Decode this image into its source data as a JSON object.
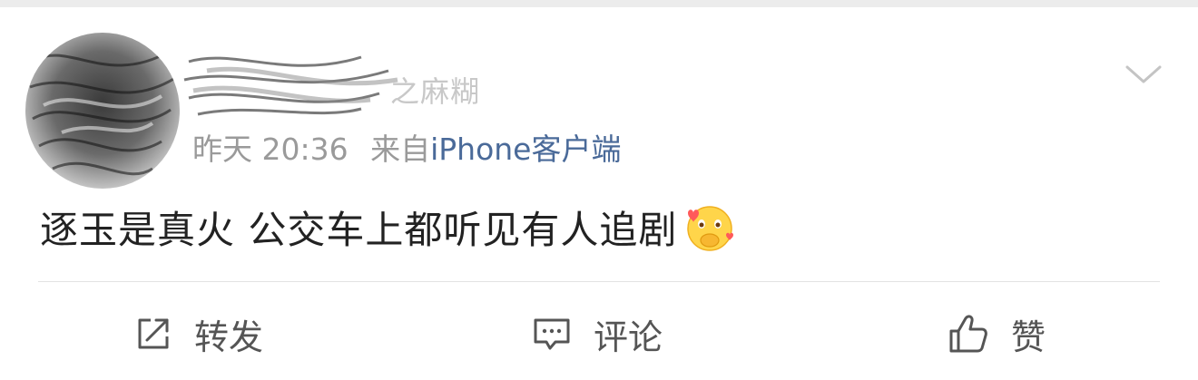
{
  "post": {
    "author": {
      "name_visible": "之麻糊",
      "avatar_icon": "blurred-avatar-icon"
    },
    "timestamp": "昨天 20:36",
    "source_prefix": "来自",
    "source": "iPhone客户端",
    "text": "逐玉是真火 公交车上都听见有人追剧",
    "emoji_icon": "heart-hands-emoji-icon",
    "menu_icon": "chevron-down-icon"
  },
  "actions": {
    "repost": {
      "label": "转发",
      "icon": "share-box-icon"
    },
    "comment": {
      "label": "评论",
      "icon": "comment-bubble-icon"
    },
    "like": {
      "label": "赞",
      "icon": "thumbs-up-icon"
    }
  },
  "colors": {
    "text": "#222222",
    "meta": "#9a9a9a",
    "link": "#4a6a99",
    "action": "#555555",
    "divider": "#e3e3e3"
  }
}
